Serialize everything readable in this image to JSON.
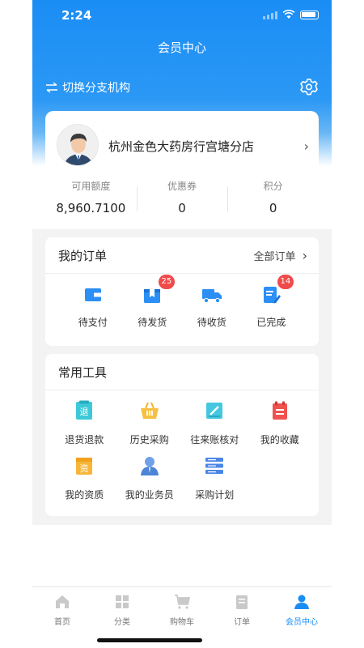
{
  "status": {
    "time": "2:24"
  },
  "header": {
    "title": "会员中心",
    "switch_label": "切换分支机构",
    "settings_icon": "gear-icon"
  },
  "profile": {
    "store_name": "杭州金色大药房行宫塘分店",
    "avatar_icon": "user-avatar"
  },
  "stats": [
    {
      "label": "可用额度",
      "value": "8,960.7100"
    },
    {
      "label": "优惠券",
      "value": "0"
    },
    {
      "label": "积分",
      "value": "0"
    }
  ],
  "orders": {
    "title": "我的订单",
    "all_label": "全部订单",
    "items": [
      {
        "label": "待支付",
        "icon": "wallet-icon",
        "badge": ""
      },
      {
        "label": "待发货",
        "icon": "package-icon",
        "badge": "25"
      },
      {
        "label": "待收货",
        "icon": "truck-icon",
        "badge": ""
      },
      {
        "label": "已完成",
        "icon": "edit-doc-icon",
        "badge": "14"
      }
    ]
  },
  "tools": {
    "title": "常用工具",
    "items": [
      {
        "label": "退货退款",
        "icon": "return-icon"
      },
      {
        "label": "历史采购",
        "icon": "basket-icon"
      },
      {
        "label": "往来账核对",
        "icon": "ledger-icon"
      },
      {
        "label": "我的收藏",
        "icon": "bookmark-icon"
      },
      {
        "label": "我的资质",
        "icon": "qualification-icon"
      },
      {
        "label": "我的业务员",
        "icon": "salesman-icon"
      },
      {
        "label": "采购计划",
        "icon": "plan-icon"
      }
    ],
    "return_glyph": "退",
    "qual_glyph": "资"
  },
  "tabbar": [
    {
      "label": "首页",
      "icon": "home-icon"
    },
    {
      "label": "分类",
      "icon": "category-icon"
    },
    {
      "label": "购物车",
      "icon": "cart-icon"
    },
    {
      "label": "订单",
      "icon": "order-icon"
    },
    {
      "label": "会员中心",
      "icon": "member-icon",
      "active": true
    }
  ],
  "colors": {
    "primary": "#1a8df5",
    "badge": "#f04a4a",
    "tab_inactive": "#c9c9c9"
  }
}
